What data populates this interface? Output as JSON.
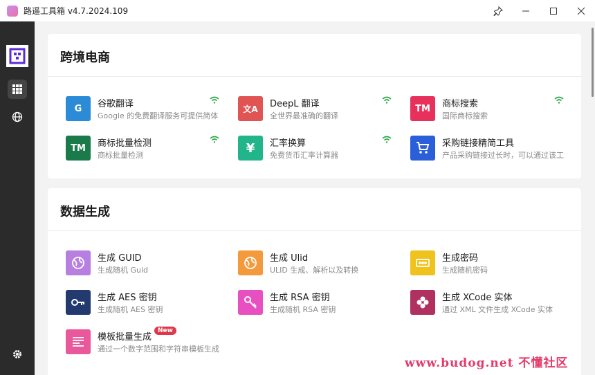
{
  "window": {
    "title": "路遥工具箱 v4.7.2024.109"
  },
  "sections": [
    {
      "title": "跨境电商",
      "tools": [
        {
          "name": "谷歌翻译",
          "desc": "Google 的免费翻译服务可提供简体",
          "icon": "google-translate-icon",
          "color": "#2b8bd6",
          "glyph": "G",
          "online": true
        },
        {
          "name": "DeepL 翻译",
          "desc": "全世界最准确的翻译",
          "icon": "translate-icon",
          "color": "#e05454",
          "glyph": "文A",
          "online": true
        },
        {
          "name": "商标搜索",
          "desc": "国际商标搜索",
          "icon": "trademark-icon",
          "color": "#e8305c",
          "glyph": "TM",
          "online": true
        },
        {
          "name": "商标批量检测",
          "desc": "商标批量检测",
          "icon": "trademark-icon",
          "color": "#1a7a4a",
          "glyph": "TM",
          "online": true
        },
        {
          "name": "汇率换算",
          "desc": "免费货币汇率计算器",
          "icon": "yen-icon",
          "color": "#22b48a",
          "glyph": "¥",
          "online": true
        },
        {
          "name": "采购链接精简工具",
          "desc": "产品采购链接过长时，可以通过该工",
          "icon": "shopping-cart-icon",
          "color": "#2a5fd9",
          "glyph": "🛒",
          "online": false
        }
      ]
    },
    {
      "title": "数据生成",
      "tools": [
        {
          "name": "生成 GUID",
          "desc": "生成随机 Guid",
          "icon": "globe-icon",
          "color": "#b67fe0",
          "glyph": "◎"
        },
        {
          "name": "生成 Ulid",
          "desc": "ULID 生成、解析以及转换",
          "icon": "globe-icon",
          "color": "#f39a3c",
          "glyph": "◎"
        },
        {
          "name": "生成密码",
          "desc": "生成随机密码",
          "icon": "password-icon",
          "color": "#f0c21e",
          "glyph": "▦"
        },
        {
          "name": "生成 AES 密钥",
          "desc": "生成随机 AES 密钥",
          "icon": "key-icon",
          "color": "#223a6e",
          "glyph": "⚷"
        },
        {
          "name": "生成 RSA 密钥",
          "desc": "生成随机 RSA 密钥",
          "icon": "key-icon",
          "color": "#e84fc0",
          "glyph": "⚷"
        },
        {
          "name": "生成 XCode 实体",
          "desc": "通过 XML 文件生成 XCode 实体",
          "icon": "puzzle-icon",
          "color": "#b03060",
          "glyph": "✤"
        },
        {
          "name": "模板批量生成",
          "desc": "通过一个数字范围和字符串模板生成",
          "icon": "template-icon",
          "color": "#e8589a",
          "glyph": "☰",
          "badge": "New"
        }
      ]
    }
  ],
  "watermark": "www.budog.net 不懂社区"
}
